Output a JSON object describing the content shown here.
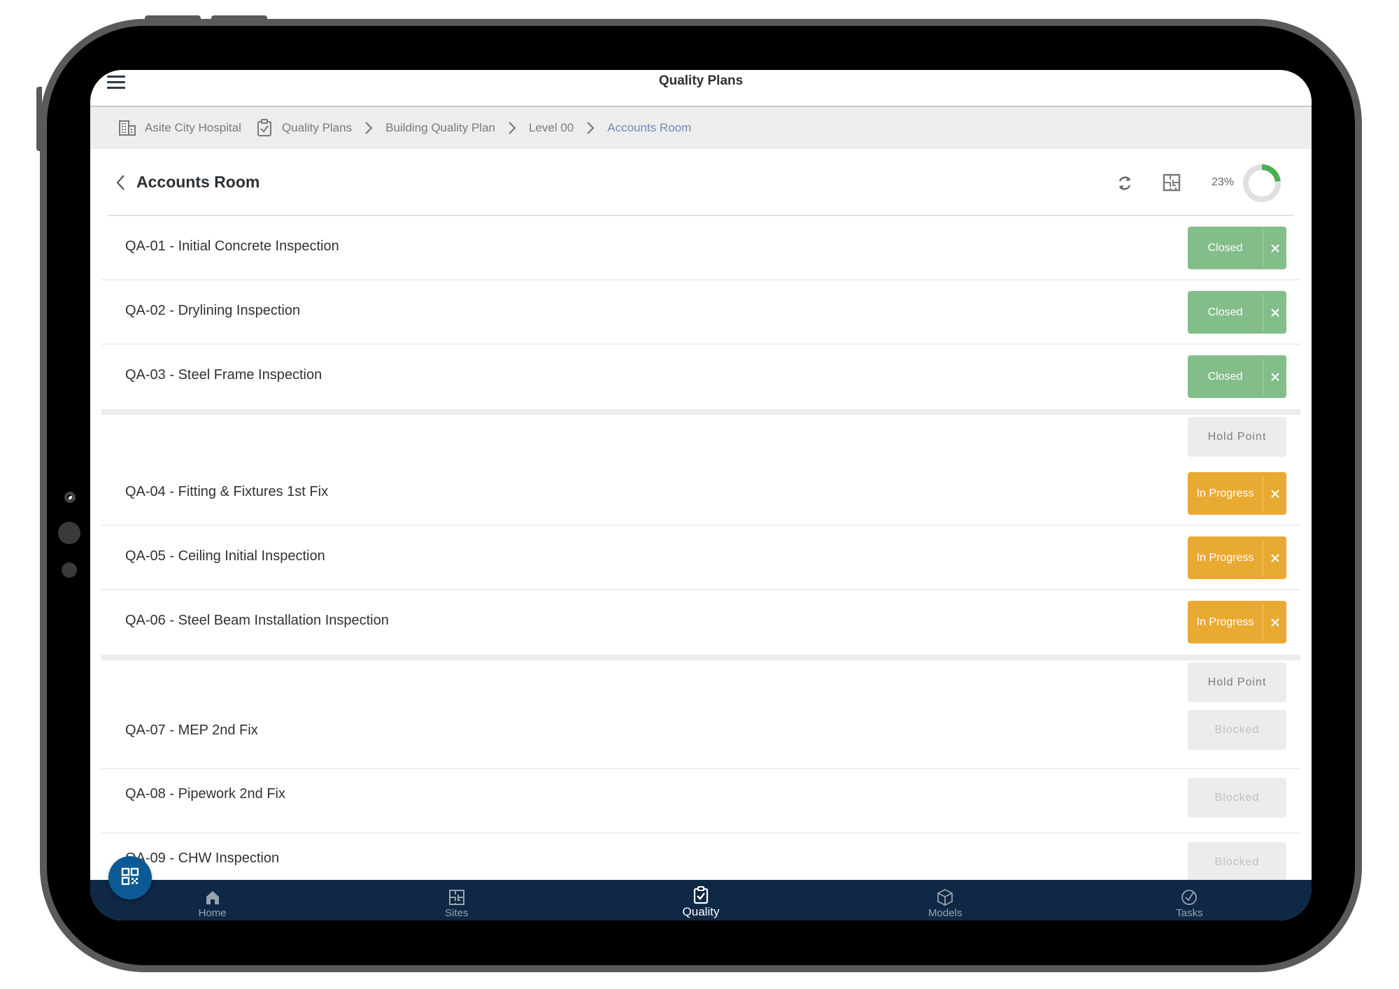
{
  "app": {
    "title": "Quality Plans"
  },
  "breadcrumb": [
    {
      "label": "Asite City Hospital",
      "icon": "building-icon"
    },
    {
      "label": "Quality Plans",
      "icon": "clipboard-check-icon"
    },
    {
      "label": "Building Quality Plan"
    },
    {
      "label": "Level 00"
    },
    {
      "label": "Accounts Room",
      "active": true
    }
  ],
  "page": {
    "title": "Accounts Room",
    "progress_label": "23%",
    "progress_fraction": 0.23
  },
  "groups": [
    {
      "items": [
        {
          "label": "QA-01 - Initial Concrete Inspection",
          "status": "Closed",
          "close_icon": "×"
        },
        {
          "label": "QA-02 - Drylining Inspection",
          "status": "Closed",
          "close_icon": "×"
        },
        {
          "label": "QA-03 - Steel Frame Inspection",
          "status": "Closed",
          "close_icon": "×"
        }
      ]
    },
    {
      "hold_point": "Hold Point",
      "items": [
        {
          "label": "QA-04 - Fitting & Fixtures 1st Fix",
          "status": "In Progress",
          "close_icon": "×"
        },
        {
          "label": "QA-05 - Ceiling Initial Inspection",
          "status": "In Progress",
          "close_icon": "×"
        },
        {
          "label": "QA-06 - Steel Beam Installation Inspection",
          "status": "In Progress",
          "close_icon": "×"
        }
      ]
    },
    {
      "hold_point": "Hold Point",
      "items": [
        {
          "label": "QA-07 - MEP 2nd Fix",
          "status": "Blocked"
        },
        {
          "label": "QA-08 - Pipework 2nd Fix",
          "status": "Blocked"
        },
        {
          "label": "QA-09 - CHW Inspection",
          "status": "Blocked"
        }
      ]
    }
  ],
  "colors": {
    "closed": "#82bd8a",
    "in_progress": "#e9aa34",
    "neutral": "#ececec",
    "nav_bg": "#0e2846",
    "fab": "#0b5a95",
    "progress_ring": "#4caf50",
    "breadcrumb_active": "#6f8db0"
  },
  "nav": [
    {
      "label": "Home",
      "icon": "home-icon"
    },
    {
      "label": "Sites",
      "icon": "floorplan-icon"
    },
    {
      "label": "Quality",
      "icon": "clipboard-check-icon",
      "active": true
    },
    {
      "label": "Models",
      "icon": "cube-icon"
    },
    {
      "label": "Tasks",
      "icon": "check-circle-icon"
    }
  ],
  "fab": {
    "icon": "qr-code-icon"
  }
}
